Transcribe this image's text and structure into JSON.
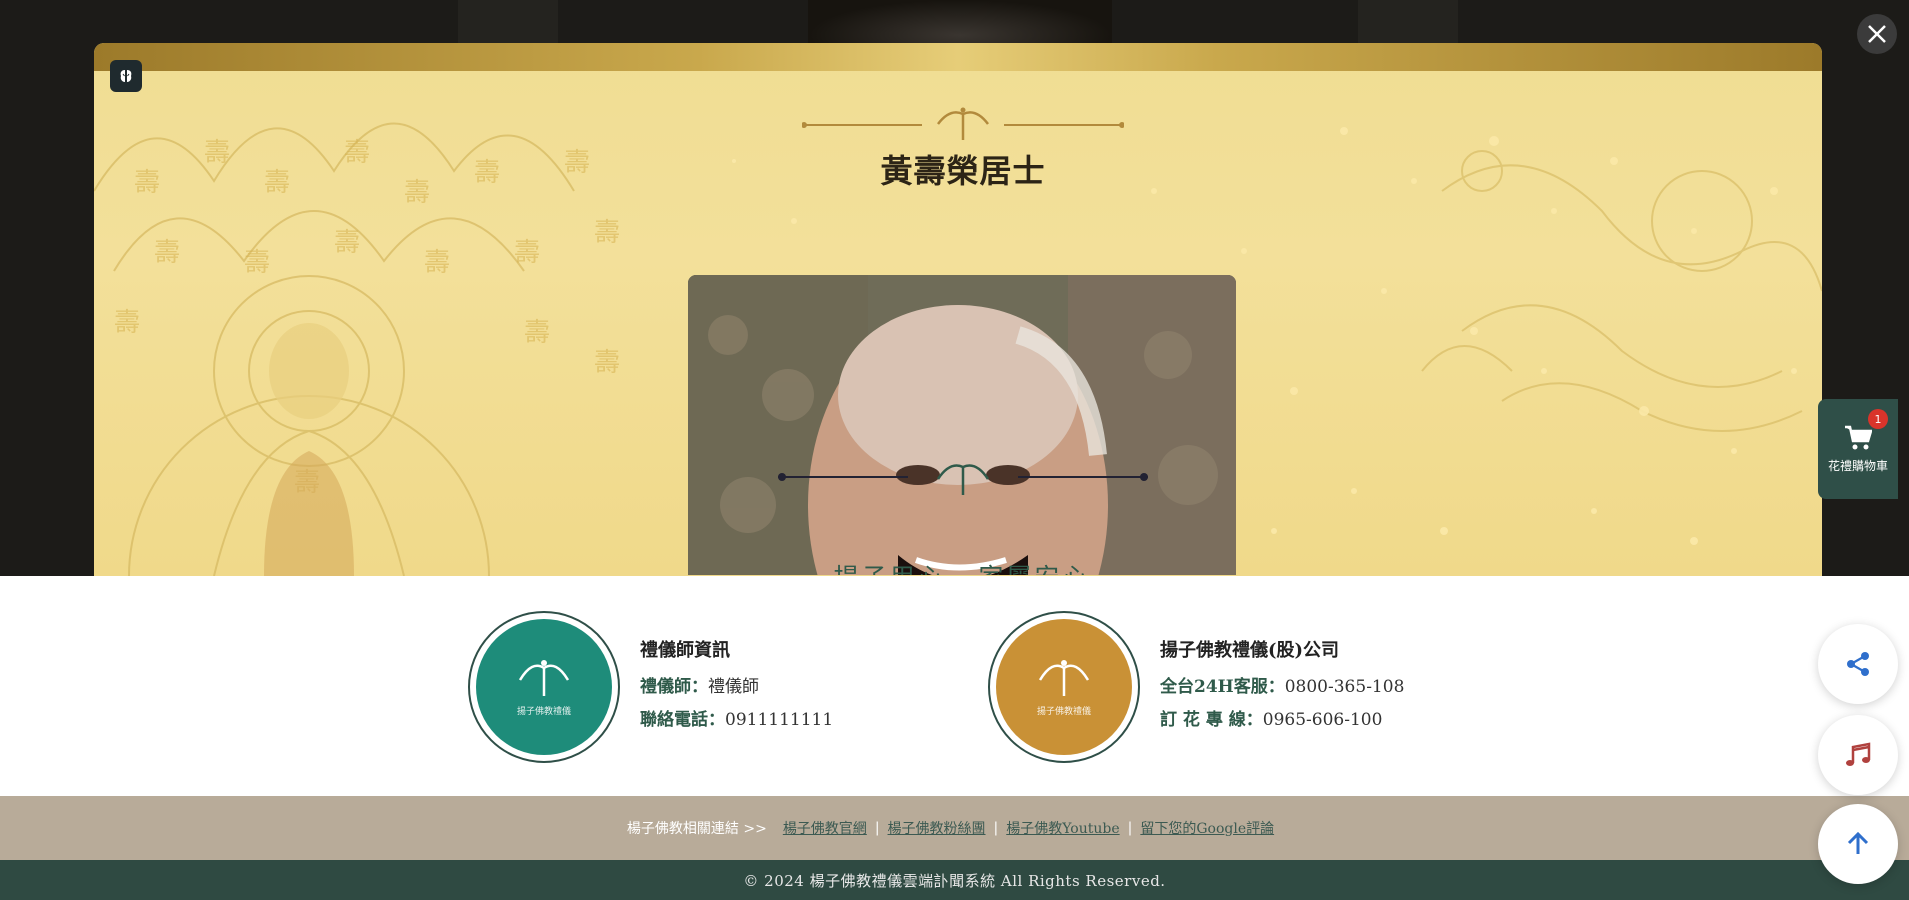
{
  "modal": {
    "title": "黃壽榮居士",
    "slogan": "揚子用心 · 家屬安心",
    "close_icon": "close-icon",
    "top_left_icon": "brain-icon"
  },
  "info": {
    "officiant": {
      "title": "禮儀師資訊",
      "logo_text": "揚子佛教禮儀",
      "logo_color": "#1e8c7a",
      "line1_key": "禮儀師：",
      "line1_val": "禮儀師",
      "line2_key": "聯絡電話：",
      "line2_val": "0911111111"
    },
    "company": {
      "title": "揚子佛教禮儀(股)公司",
      "logo_text": "揚子佛教禮儀",
      "logo_color": "#c99136",
      "line1_key": "全台24H客服：",
      "line1_val": "0800-365-108",
      "line2_key": "訂 花 專 線：",
      "line2_val": "0965-606-100"
    }
  },
  "links": {
    "prefix": "楊子佛教相關連結 >>",
    "items": [
      "楊子佛教官網",
      "楊子佛教粉絲團",
      "楊子佛教Youtube",
      "留下您的Google評論"
    ],
    "separator": "|"
  },
  "footer": {
    "copyright": "© 2024 楊子佛教禮儀雲端訃聞系統 All Rights Reserved."
  },
  "widgets": {
    "cart_label": "花禮購物車",
    "cart_count": "1",
    "cart_icon": "cart-icon",
    "share_icon": "share-icon",
    "music_icon": "music-icon",
    "top_icon": "arrow-up-icon"
  },
  "colors": {
    "accent_green": "#2f4f48",
    "gold": "#c9a84c",
    "badge_red": "#d9342b"
  }
}
